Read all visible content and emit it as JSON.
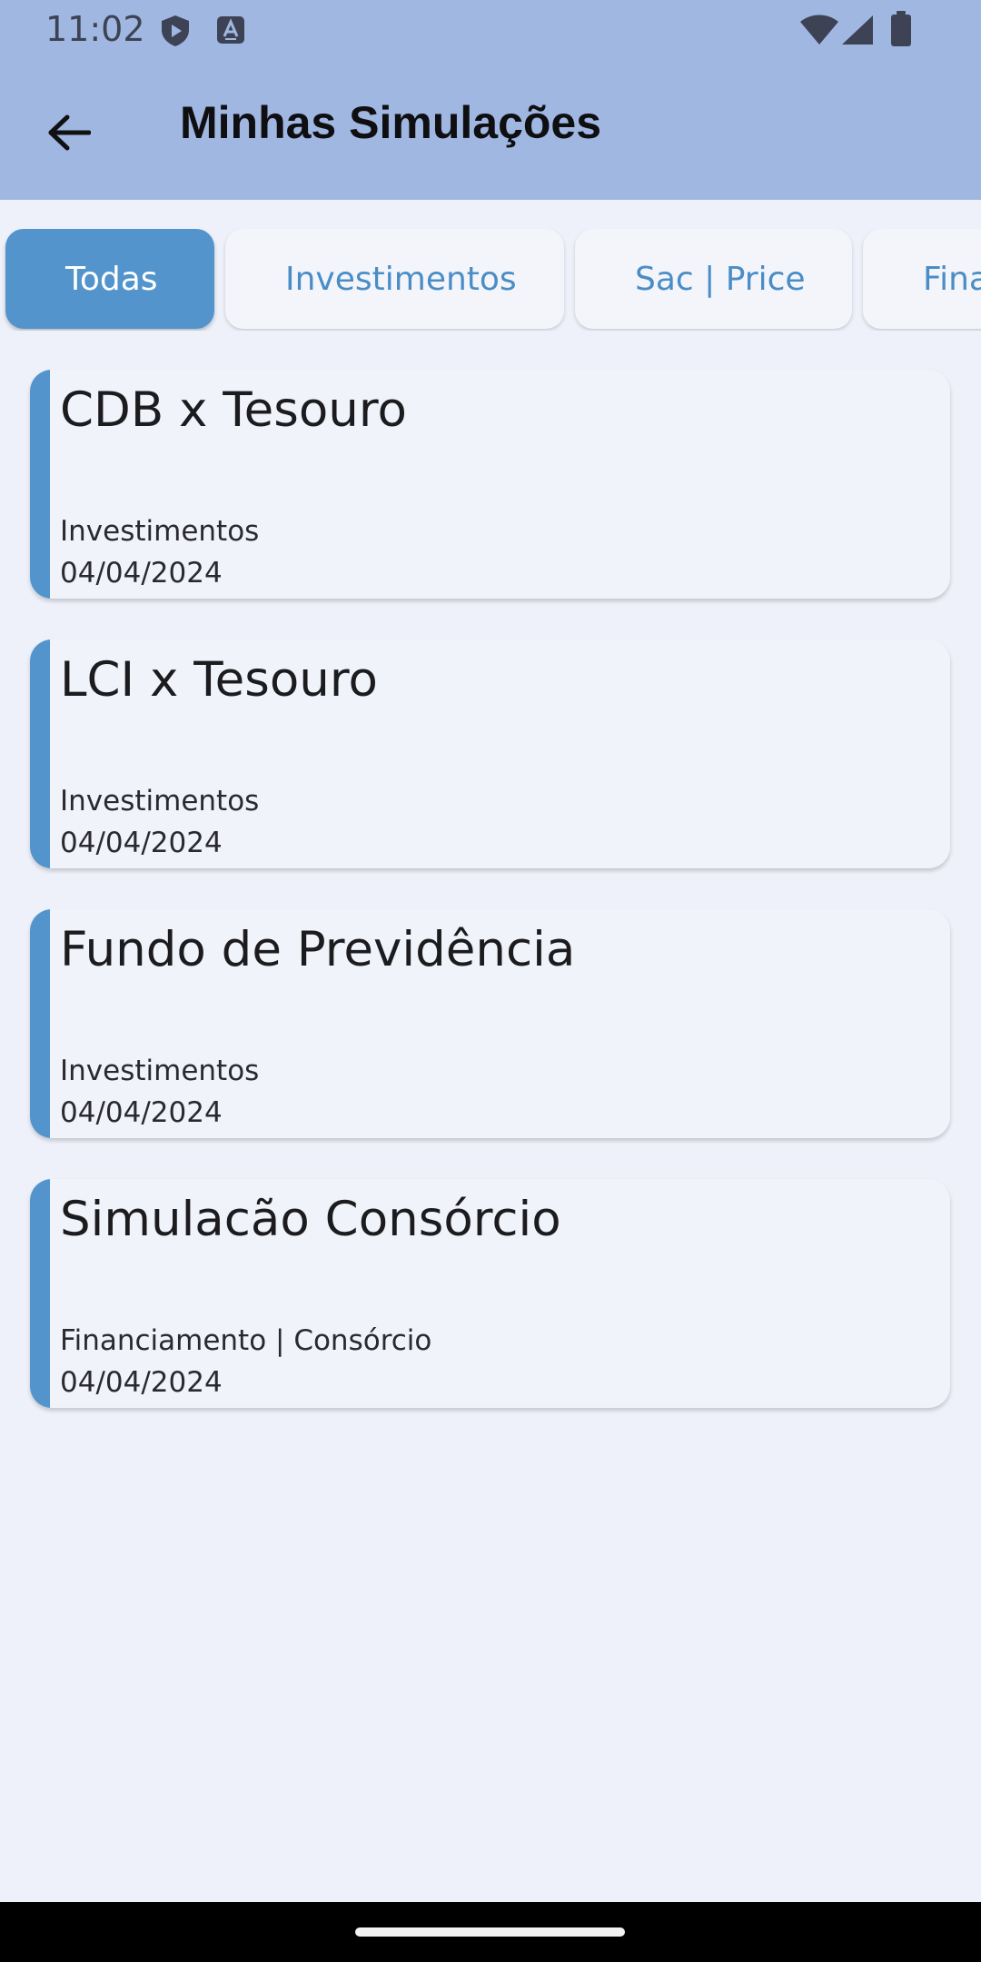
{
  "status_bar": {
    "time": "11:02",
    "icons": [
      "shield-play-icon",
      "text-a-icon",
      "wifi-icon",
      "signal-icon",
      "battery-icon"
    ]
  },
  "app_bar": {
    "back_icon": "arrow-left-icon",
    "title": "Minhas Simulações"
  },
  "tabs": [
    {
      "label": "Todas",
      "selected": true
    },
    {
      "label": "Investimentos",
      "selected": false
    },
    {
      "label": "Sac | Price",
      "selected": false
    },
    {
      "label": "Fina",
      "selected": false
    }
  ],
  "simulations": [
    {
      "title": "CDB x Tesouro",
      "category": "Investimentos",
      "date": "04/04/2024"
    },
    {
      "title": "LCI x Tesouro",
      "category": "Investimentos",
      "date": "04/04/2024"
    },
    {
      "title": "Fundo de Previdência",
      "category": "Investimentos",
      "date": "04/04/2024"
    },
    {
      "title": "Simulacão Consórcio",
      "category": "Financiamento | Consórcio",
      "date": "04/04/2024"
    }
  ],
  "colors": {
    "top_bar": "#a0b7e2",
    "background": "#eef1fa",
    "accent": "#5294cb",
    "card": "#f1f3fb"
  }
}
